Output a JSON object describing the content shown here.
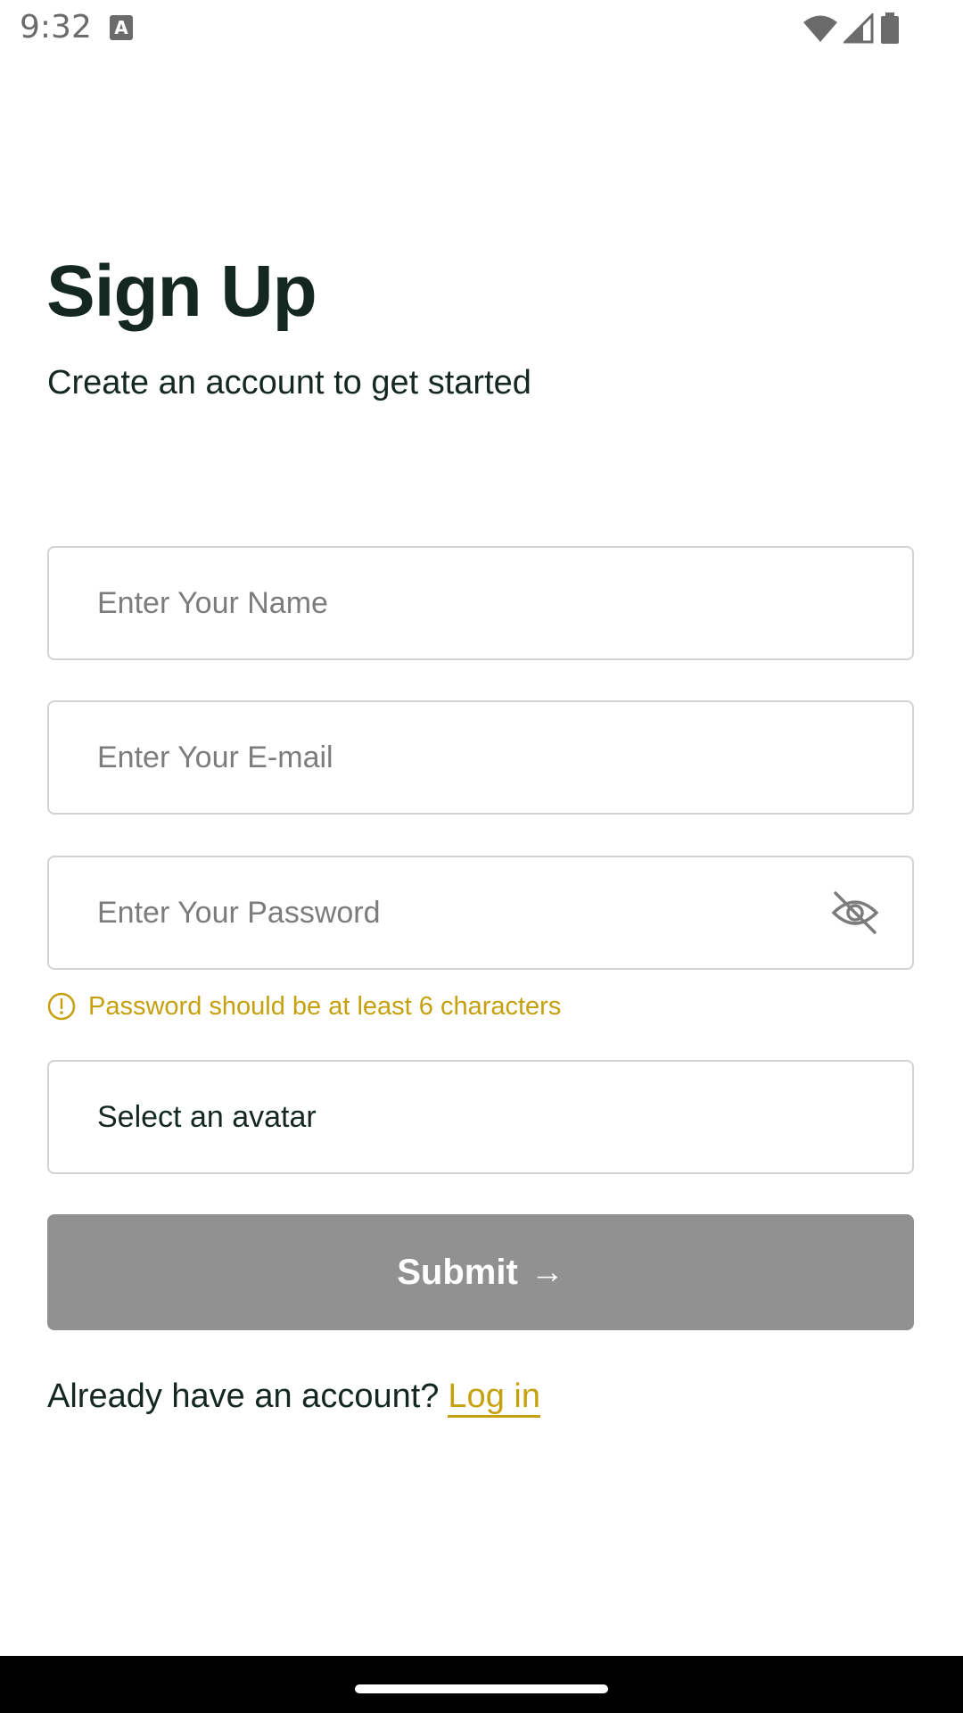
{
  "status_bar": {
    "time": "9:32",
    "keyboard_indicator": "A"
  },
  "header": {
    "title": "Sign Up",
    "subtitle": "Create an account to get started"
  },
  "form": {
    "name_placeholder": "Enter Your Name",
    "email_placeholder": "Enter Your E-mail",
    "password_placeholder": "Enter Your Password",
    "password_error": "Password should be at least 6 characters",
    "avatar_label": "Select an avatar",
    "submit_label": "Submit",
    "submit_arrow": "→"
  },
  "footer": {
    "prompt": "Already have an account?",
    "login_label": "Log in"
  },
  "colors": {
    "primary_text": "#142821",
    "accent": "#c6a00e",
    "button_disabled": "#919191",
    "border": "#d3d3d3"
  },
  "icons": [
    "wifi-icon",
    "signal-icon",
    "battery-icon",
    "eye-off-icon",
    "alert-circle-icon"
  ]
}
